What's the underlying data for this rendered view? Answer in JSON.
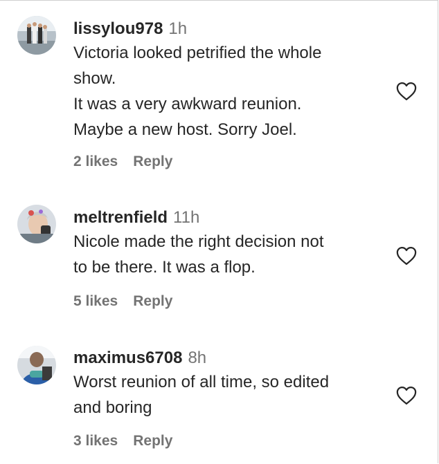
{
  "comments": [
    {
      "username": "lissylou978",
      "time": "1h",
      "lines": [
        "Victoria looked petrified the whole",
        "show.",
        "It was a very awkward reunion.",
        "Maybe a new host. Sorry Joel."
      ],
      "likes": "2 likes",
      "reply": "Reply",
      "avatar_icon": "user-photo-avatar",
      "like_icon": "heart-outline-icon"
    },
    {
      "username": "meltrenfield",
      "time": "11h",
      "lines": [
        "Nicole made the right decision not",
        "to be there. It was a flop."
      ],
      "likes": "5 likes",
      "reply": "Reply",
      "avatar_icon": "user-photo-avatar",
      "like_icon": "heart-outline-icon"
    },
    {
      "username": "maximus6708",
      "time": "8h",
      "lines": [
        "Worst reunion of all time, so edited",
        "and boring"
      ],
      "likes": "3 likes",
      "reply": "Reply",
      "avatar_icon": "user-photo-avatar",
      "like_icon": "heart-outline-icon"
    }
  ],
  "colors": {
    "text": "#262626",
    "secondary": "#737373",
    "background": "#ffffff"
  }
}
